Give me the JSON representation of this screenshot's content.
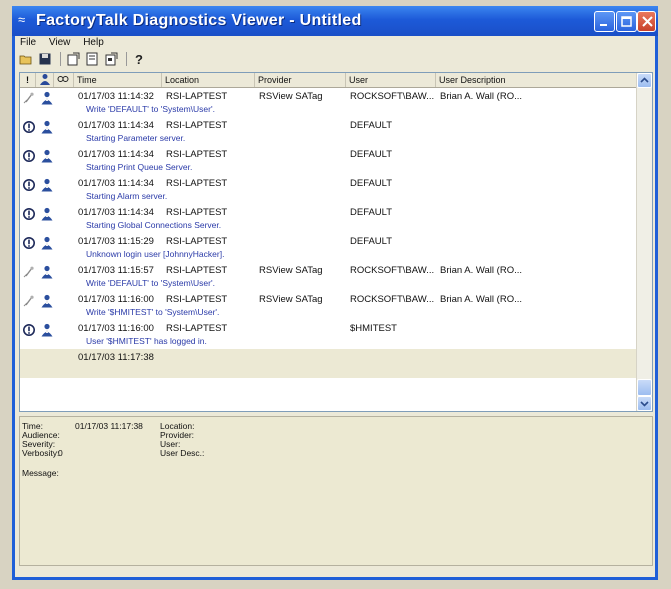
{
  "window": {
    "title": "FactoryTalk Diagnostics Viewer - Untitled"
  },
  "menu": [
    "File",
    "View",
    "Help"
  ],
  "toolbar": {
    "icons": [
      "open-icon",
      "save-icon",
      "export-icon",
      "print-preview-icon",
      "properties-icon",
      "help-icon"
    ]
  },
  "grid": {
    "columns": [
      "!",
      "",
      "",
      "Time",
      "Location",
      "Provider",
      "User",
      "User Description"
    ],
    "rows": [
      {
        "icon": "audit",
        "time": "01/17/03 11:14:32",
        "location": "RSI-LAPTEST",
        "provider": "RSView SATag",
        "user": "ROCKSOFT\\BAW...",
        "user_desc": "Brian A. Wall (RO...",
        "message": "Write 'DEFAULT' to 'System\\User'."
      },
      {
        "icon": "info",
        "time": "01/17/03 11:14:34",
        "location": "RSI-LAPTEST",
        "provider": "",
        "user": "DEFAULT",
        "user_desc": "",
        "message": "Starting Parameter server."
      },
      {
        "icon": "info",
        "time": "01/17/03 11:14:34",
        "location": "RSI-LAPTEST",
        "provider": "",
        "user": "DEFAULT",
        "user_desc": "",
        "message": "Starting Print Queue Server."
      },
      {
        "icon": "info",
        "time": "01/17/03 11:14:34",
        "location": "RSI-LAPTEST",
        "provider": "",
        "user": "DEFAULT",
        "user_desc": "",
        "message": "Starting Alarm server."
      },
      {
        "icon": "info",
        "time": "01/17/03 11:14:34",
        "location": "RSI-LAPTEST",
        "provider": "",
        "user": "DEFAULT",
        "user_desc": "",
        "message": "Starting Global Connections Server."
      },
      {
        "icon": "info",
        "time": "01/17/03 11:15:29",
        "location": "RSI-LAPTEST",
        "provider": "",
        "user": "DEFAULT",
        "user_desc": "",
        "message": "Unknown login user [JohnnyHacker]."
      },
      {
        "icon": "audit",
        "time": "01/17/03 11:15:57",
        "location": "RSI-LAPTEST",
        "provider": "RSView SATag",
        "user": "ROCKSOFT\\BAW...",
        "user_desc": "Brian A. Wall (RO...",
        "message": "Write 'DEFAULT' to 'System\\User'."
      },
      {
        "icon": "audit",
        "time": "01/17/03 11:16:00",
        "location": "RSI-LAPTEST",
        "provider": "RSView SATag",
        "user": "ROCKSOFT\\BAW...",
        "user_desc": "Brian A. Wall (RO...",
        "message": "Write '$HMITEST' to 'System\\User'."
      },
      {
        "icon": "info",
        "time": "01/17/03 11:16:00",
        "location": "RSI-LAPTEST",
        "provider": "",
        "user": "$HMITEST",
        "user_desc": "",
        "message": "User '$HMITEST' has logged in."
      },
      {
        "icon": "none",
        "time": "01/17/03 11:17:38",
        "location": "",
        "provider": "",
        "user": "",
        "user_desc": "",
        "message": "",
        "selected": true
      }
    ]
  },
  "details": {
    "time_label": "Time:",
    "time_value": "01/17/03 11:17:38",
    "audience_label": "Audience:",
    "severity_label": "Severity:",
    "verbosity_label": "Verbosity:",
    "verbosity_value": "0",
    "message_label": "Message:",
    "location_label": "Location:",
    "provider_label": "Provider:",
    "user_label": "User:",
    "user_desc_label": "User Desc.:"
  },
  "colors": {
    "titlebar": "#1d5ad8",
    "message_text": "#2a3aa8",
    "selected_row": "#ece9d4"
  }
}
